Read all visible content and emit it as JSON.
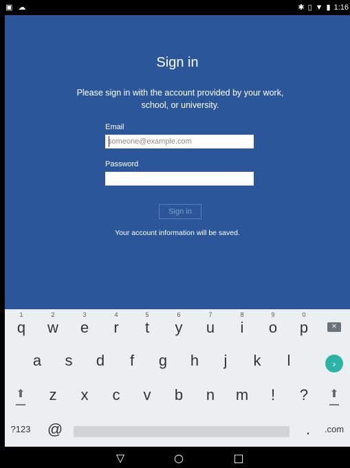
{
  "status_bar": {
    "left_icons": [
      "image-icon",
      "cloud-upload-icon"
    ],
    "right_icons": [
      "bluetooth-icon",
      "vibrate-icon",
      "wifi-icon",
      "battery-icon"
    ],
    "time": "1:16"
  },
  "signin": {
    "title": "Sign in",
    "description": "Please sign in with the account provided by your work, school, or university.",
    "email_label": "Email",
    "email_placeholder": "someone@example.com",
    "email_value": "",
    "password_label": "Password",
    "password_value": "",
    "signin_button": "Sign in",
    "saved_note": "Your account information will be saved."
  },
  "keyboard": {
    "row1": [
      {
        "hint": "1",
        "key": "q"
      },
      {
        "hint": "2",
        "key": "w"
      },
      {
        "hint": "3",
        "key": "e"
      },
      {
        "hint": "4",
        "key": "r"
      },
      {
        "hint": "5",
        "key": "t"
      },
      {
        "hint": "6",
        "key": "y"
      },
      {
        "hint": "7",
        "key": "u"
      },
      {
        "hint": "8",
        "key": "i"
      },
      {
        "hint": "9",
        "key": "o"
      },
      {
        "hint": "0",
        "key": "p"
      }
    ],
    "row2": [
      "a",
      "s",
      "d",
      "f",
      "g",
      "h",
      "j",
      "k",
      "l"
    ],
    "row3": [
      "z",
      "x",
      "c",
      "v",
      "b",
      "n",
      "m",
      "!",
      "?"
    ],
    "symbols_key": "?123",
    "at_key": "@",
    "period_key": ".",
    "dotcom_key": ".com",
    "backspace_icon": "backspace-icon",
    "enter_icon": "enter-icon",
    "shift_icon": "shift-icon",
    "enter_color": "#2bb3a6"
  },
  "nav_bar": {
    "back_icon": "back-triangle-icon",
    "home_icon": "home-circle-icon",
    "recents_icon": "recents-square-icon"
  },
  "colors": {
    "background": "#2b579a",
    "keyboard": "#eceff1"
  }
}
